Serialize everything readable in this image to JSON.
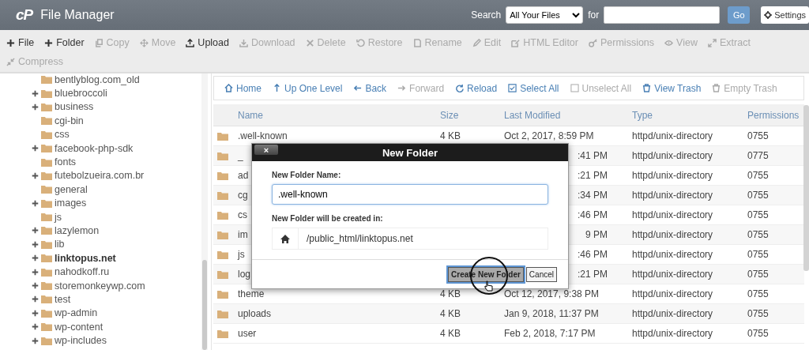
{
  "header": {
    "logo": "cP",
    "title": "File Manager",
    "search_label": "Search",
    "search_scope": "All Your Files",
    "for_label": "for",
    "go_button": "Go",
    "settings_button": "Settings"
  },
  "toolbar": [
    {
      "label": "File",
      "disabled": false
    },
    {
      "label": "Folder",
      "disabled": false
    },
    {
      "label": "Copy",
      "disabled": true
    },
    {
      "label": "Move",
      "disabled": true
    },
    {
      "label": "Upload",
      "disabled": false
    },
    {
      "label": "Download",
      "disabled": true
    },
    {
      "label": "Delete",
      "disabled": true
    },
    {
      "label": "Restore",
      "disabled": true
    },
    {
      "label": "Rename",
      "disabled": true
    },
    {
      "label": "Edit",
      "disabled": true
    },
    {
      "label": "HTML Editor",
      "disabled": true
    },
    {
      "label": "Permissions",
      "disabled": true
    },
    {
      "label": "View",
      "disabled": true
    },
    {
      "label": "Extract",
      "disabled": true
    },
    {
      "label": "Compress",
      "disabled": true
    }
  ],
  "tree": {
    "items": [
      {
        "name": "bentlyblog.com_old",
        "expandable": false,
        "selected": false
      },
      {
        "name": "bluebroccoli",
        "expandable": true,
        "selected": false
      },
      {
        "name": "business",
        "expandable": true,
        "selected": false
      },
      {
        "name": "cgi-bin",
        "expandable": false,
        "selected": false
      },
      {
        "name": "css",
        "expandable": false,
        "selected": false
      },
      {
        "name": "facebook-php-sdk",
        "expandable": true,
        "selected": false
      },
      {
        "name": "fonts",
        "expandable": false,
        "selected": false
      },
      {
        "name": "futebolzueira.com.br",
        "expandable": true,
        "selected": false
      },
      {
        "name": "general",
        "expandable": false,
        "selected": false
      },
      {
        "name": "images",
        "expandable": true,
        "selected": false
      },
      {
        "name": "js",
        "expandable": false,
        "selected": false
      },
      {
        "name": "lazylemon",
        "expandable": true,
        "selected": false
      },
      {
        "name": "lib",
        "expandable": true,
        "selected": false
      },
      {
        "name": "linktopus.net",
        "expandable": true,
        "selected": true
      },
      {
        "name": "nahodkoff.ru",
        "expandable": true,
        "selected": false
      },
      {
        "name": "storemonkeywp.com",
        "expandable": true,
        "selected": false
      },
      {
        "name": "test",
        "expandable": true,
        "selected": false
      },
      {
        "name": "wp-admin",
        "expandable": true,
        "selected": false
      },
      {
        "name": "wp-content",
        "expandable": true,
        "selected": false
      },
      {
        "name": "wp-includes",
        "expandable": true,
        "selected": false
      }
    ]
  },
  "nav_toolbar": [
    {
      "label": "Home",
      "disabled": false
    },
    {
      "label": "Up One Level",
      "disabled": false
    },
    {
      "label": "Back",
      "disabled": false
    },
    {
      "label": "Forward",
      "disabled": true
    },
    {
      "label": "Reload",
      "disabled": false
    },
    {
      "label": "Select All",
      "disabled": false
    },
    {
      "label": "Unselect All",
      "disabled": true
    },
    {
      "label": "View Trash",
      "disabled": false
    },
    {
      "label": "Empty Trash",
      "disabled": true
    }
  ],
  "table": {
    "columns": [
      "Name",
      "Size",
      "Last Modified",
      "Type",
      "Permissions"
    ],
    "rows": [
      {
        "kind": "full",
        "name": ".well-known",
        "size": "4 KB",
        "modified": "Oct 2, 2017, 8:59 PM",
        "type": "httpd/unix-directory",
        "permissions": "0755"
      },
      {
        "kind": "covered",
        "name": "_",
        "modified": ":41 PM",
        "type": "httpd/unix-directory",
        "permissions": "0775"
      },
      {
        "kind": "covered",
        "name": "ad",
        "modified": ":21 PM",
        "type": "httpd/unix-directory",
        "permissions": "0755"
      },
      {
        "kind": "covered",
        "name": "cg",
        "modified": ":34 PM",
        "type": "httpd/unix-directory",
        "permissions": "0755"
      },
      {
        "kind": "covered",
        "name": "cs",
        "modified": ":46 PM",
        "type": "httpd/unix-directory",
        "permissions": "0755"
      },
      {
        "kind": "covered",
        "name": "im",
        "modified": "9 PM",
        "type": "httpd/unix-directory",
        "permissions": "0755"
      },
      {
        "kind": "covered",
        "name": "js",
        "modified": ":46 PM",
        "type": "httpd/unix-directory",
        "permissions": "0755"
      },
      {
        "kind": "covered",
        "name": "log",
        "modified": ":21 PM",
        "type": "httpd/unix-directory",
        "permissions": "0755"
      },
      {
        "kind": "full",
        "name": "theme",
        "size": "4 KB",
        "modified": "Oct 12, 2017, 9:38 PM",
        "type": "httpd/unix-directory",
        "permissions": "0755"
      },
      {
        "kind": "full",
        "name": "uploads",
        "size": "4 KB",
        "modified": "Jan 9, 2018, 11:37 PM",
        "type": "httpd/unix-directory",
        "permissions": "0755"
      },
      {
        "kind": "full",
        "name": "user",
        "size": "4 KB",
        "modified": "Feb 2, 2018, 7:17 PM",
        "type": "httpd/unix-directory",
        "permissions": "0755"
      }
    ]
  },
  "dialog": {
    "title": "New Folder",
    "close": "×",
    "name_label": "New Folder Name:",
    "name_value": ".well-known",
    "location_label": "New Folder will be created in:",
    "location": "/public_html/linktopus.net",
    "buttons": [
      {
        "label": "Create New Folder",
        "kind": "primary"
      },
      {
        "label": "Cancel",
        "kind": "secondary"
      }
    ]
  }
}
